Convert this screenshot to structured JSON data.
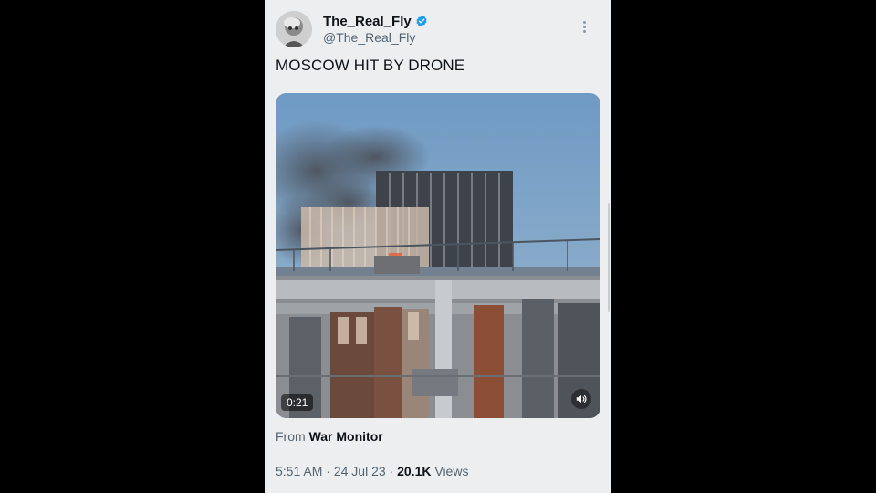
{
  "author": {
    "display_name": "The_Real_Fly",
    "handle": "@The_Real_Fly",
    "verified": true,
    "verified_color": "#1d9bf0"
  },
  "tweet": {
    "text": "MOSCOW HIT BY DRONE"
  },
  "media": {
    "type": "video",
    "duration": "0:21",
    "volume_icon": "speaker-icon"
  },
  "source": {
    "prefix": "From",
    "name": "War Monitor"
  },
  "meta": {
    "time": "5:51 AM",
    "separator": "·",
    "date": "24 Jul 23",
    "views_count": "20.1K",
    "views_label": "Views"
  }
}
